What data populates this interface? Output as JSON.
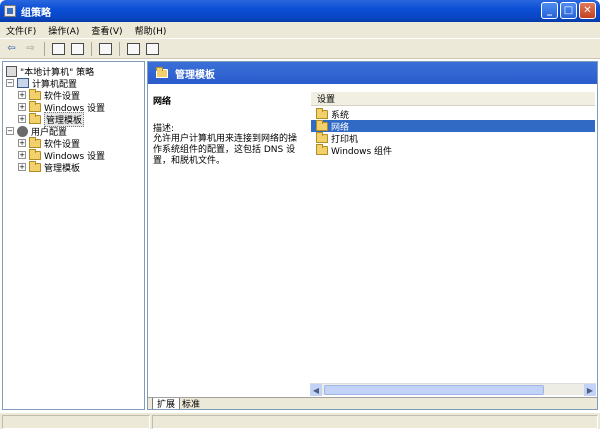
{
  "window": {
    "title": "组策略"
  },
  "menubar": {
    "items": [
      "文件(F)",
      "操作(A)",
      "查看(V)",
      "帮助(H)"
    ]
  },
  "toolbar": {
    "buttons": [
      "back-icon",
      "forward-icon",
      "up-folder-icon",
      "show-hide-tree-icon",
      "export-list-icon",
      "properties-icon",
      "help-icon"
    ]
  },
  "tree": {
    "root": "\"本地计算机\" 策略",
    "computer_config": "计算机配置",
    "computer_software": "软件设置",
    "computer_windows": "Windows 设置",
    "computer_admin": "管理模板",
    "user_config": "用户配置",
    "user_software": "软件设置",
    "user_windows": "Windows 设置",
    "user_admin": "管理模板"
  },
  "main": {
    "header_title": "管理模板",
    "selected_title": "网络",
    "desc_label": "描述:",
    "desc_text": "允许用户计算机用来连接到网络的操作系统组件的配置，这包括 DNS 设置，和脱机文件。",
    "list_header": "设置",
    "items": [
      "系统",
      "网络",
      "打印机",
      "Windows 组件"
    ],
    "tabs": [
      "扩展",
      "标准"
    ]
  },
  "colors": {
    "titlebar": "#0b4fd6",
    "selection": "#316ac5",
    "chrome": "#ece9d8"
  }
}
